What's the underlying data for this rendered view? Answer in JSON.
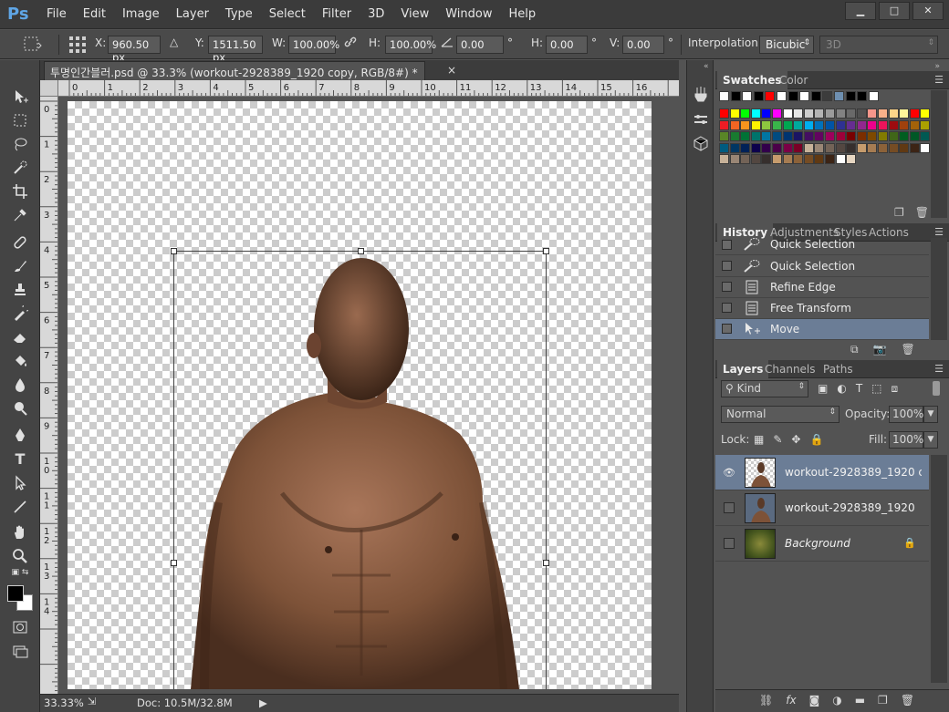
{
  "app": {
    "logo": "Ps"
  },
  "menu": [
    "File",
    "Edit",
    "Image",
    "Layer",
    "Type",
    "Select",
    "Filter",
    "3D",
    "View",
    "Window",
    "Help"
  ],
  "window_controls": {
    "minimize": "▁",
    "maximize": "□",
    "close": "✕"
  },
  "options": {
    "x_label": "X:",
    "x_value": "960.50 px",
    "y_label": "Y:",
    "y_value": "1511.50 px",
    "w_label": "W:",
    "w_value": "100.00%",
    "h_label": "H:",
    "h_value": "100.00%",
    "angle_value": "0.00",
    "hskew_label": "H:",
    "hskew_value": "0.00",
    "vskew_label": "V:",
    "vskew_value": "0.00",
    "degree": "°",
    "interp_label": "Interpolation:",
    "interp_value": "Bicubic",
    "mode_3d": "3D"
  },
  "document": {
    "tab_title": "투명인간블러.psd @ 33.3% (workout-2928389_1920 copy, RGB/8#) *",
    "close": "×"
  },
  "ruler_top": [
    "0",
    "1",
    "2",
    "3",
    "4",
    "5",
    "6",
    "7",
    "8",
    "9",
    "10",
    "11",
    "12",
    "13",
    "14",
    "15",
    "16"
  ],
  "ruler_left": [
    "0",
    "1",
    "2",
    "3",
    "4",
    "5",
    "6",
    "7",
    "8",
    "9",
    "10",
    "11",
    "12",
    "13",
    "14"
  ],
  "status": {
    "zoom": "33.33%",
    "doc": "Doc: 10.5M/32.8M",
    "arrow": "▶"
  },
  "swatches_panel": {
    "tabs": [
      "Swatches",
      "Color"
    ],
    "colors_row1": [
      "#ffffff",
      "#000000",
      "#ffffff",
      "#000000",
      "#ff0000",
      "#ffffff",
      "#000000",
      "#ffffff",
      "#000000",
      "#3c3c3c",
      "#6e8fb0",
      "#000000",
      "#000000",
      "#ffffff"
    ],
    "colors_rows": [
      [
        "#ff0000",
        "#ffff00",
        "#00ff00",
        "#00ffff",
        "#0000ff",
        "#ff00ff",
        "#ffffff",
        "#e6e6e6",
        "#cdcdcd",
        "#b4b4b4",
        "#9b9b9b",
        "#828282",
        "#696969",
        "#505050",
        "#f6968b",
        "#f9b089",
        "#fcd489",
        "#fff799",
        "#ff0000",
        "#ffff00"
      ],
      [
        "#ee1c24",
        "#f26522",
        "#f7941d",
        "#fff200",
        "#8dc63f",
        "#39b54a",
        "#00a651",
        "#00a99d",
        "#00aeef",
        "#0072bc",
        "#0054a6",
        "#2e3192",
        "#662d91",
        "#92278f",
        "#ec008c",
        "#ed145b",
        "#9e0b0f",
        "#a0410d",
        "#a36209",
        "#aba000"
      ],
      [
        "#598527",
        "#197b30",
        "#007236",
        "#00746b",
        "#0076a3",
        "#004b80",
        "#003471",
        "#1b1464",
        "#440e62",
        "#630460",
        "#9e005d",
        "#9e0039",
        "#790000",
        "#7b2e00",
        "#7d4900",
        "#827b00",
        "#406618",
        "#005e20",
        "#005826",
        "#005952"
      ],
      [
        "#005b7f",
        "#003663",
        "#002157",
        "#0d004c",
        "#32004b",
        "#4b0049",
        "#7b0046",
        "#7a0026",
        "#c7b299",
        "#998675",
        "#736357",
        "#534741",
        "#362f2d",
        "#c69c6d",
        "#a67c52",
        "#8c6239",
        "#754c24",
        "#603913",
        "#3c2415",
        "#ffffff"
      ]
    ]
  },
  "history_panel": {
    "tabs": [
      "History",
      "Adjustments",
      "Styles",
      "Actions"
    ],
    "items": [
      {
        "label": "Quick Selection",
        "icon": "quick-selection-icon"
      },
      {
        "label": "Quick Selection",
        "icon": "quick-selection-icon"
      },
      {
        "label": "Refine Edge",
        "icon": "document-icon"
      },
      {
        "label": "Free Transform",
        "icon": "document-icon"
      },
      {
        "label": "Move",
        "icon": "move-icon"
      }
    ]
  },
  "layers_panel": {
    "tabs": [
      "Layers",
      "Channels",
      "Paths"
    ],
    "kind": "Kind",
    "blend_mode": "Normal",
    "opacity_label": "Opacity:",
    "opacity_value": "100%",
    "lock_label": "Lock:",
    "fill_label": "Fill:",
    "fill_value": "100%",
    "layers": [
      {
        "name": "workout-2928389_1920 co...",
        "visible": true,
        "selected": true
      },
      {
        "name": "workout-2928389_1920",
        "visible": false,
        "selected": false
      },
      {
        "name": "Background",
        "visible": false,
        "selected": false,
        "locked": true
      }
    ],
    "footer": [
      "link-icon",
      "fx",
      "mask-icon",
      "adjustment-icon",
      "folder-icon",
      "new-layer-icon",
      "trash-icon"
    ]
  },
  "colors": {
    "accent_selection": "#6b7d96",
    "ps_blue": "#5fa6e6"
  }
}
